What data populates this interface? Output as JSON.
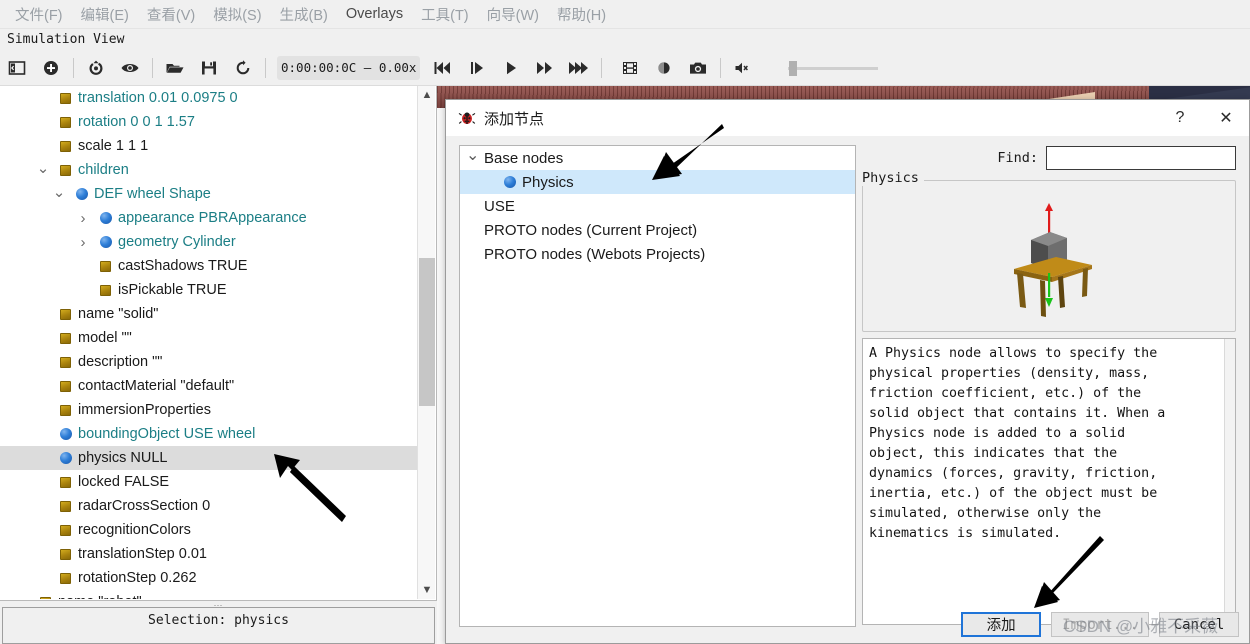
{
  "menubar": {
    "items": [
      {
        "label": "文件(F)",
        "muted": true
      },
      {
        "label": "编辑(E)",
        "muted": true
      },
      {
        "label": "查看(V)",
        "muted": true
      },
      {
        "label": "模拟(S)",
        "muted": true
      },
      {
        "label": "生成(B)",
        "muted": true
      },
      {
        "label": "Overlays",
        "muted": false
      },
      {
        "label": "工具(T)",
        "muted": true
      },
      {
        "label": "向导(W)",
        "muted": true
      },
      {
        "label": "帮助(H)",
        "muted": true
      }
    ]
  },
  "dock": {
    "title": "Simulation View"
  },
  "toolbar": {
    "time": "0:00:00:0C —  0.00x",
    "icons": [
      "sidebar-toggle-icon",
      "add-node-icon",
      "restore-viewpoint-icon",
      "view-icon",
      "open-world-icon",
      "save-world-icon",
      "reload-world-icon"
    ],
    "transport": [
      "rewind-icon",
      "step-icon",
      "play-icon",
      "fast-forward-icon",
      "realtime-icon"
    ],
    "media": [
      "movie-icon",
      "record-icon",
      "screenshot-icon"
    ],
    "sound": "mute-icon"
  },
  "scene_tree": {
    "rows": [
      {
        "twisty": "",
        "icon": "sf-field-icon",
        "indent": 60,
        "text": "translation 0.01 0.0975 0",
        "color": "teal",
        "selected": false
      },
      {
        "twisty": "",
        "icon": "sf-field-icon",
        "indent": 60,
        "text": "rotation 0 0 1 1.57",
        "color": "teal",
        "selected": false
      },
      {
        "twisty": "",
        "icon": "sf-field-icon",
        "indent": 60,
        "text": "scale 1 1 1",
        "color": "black",
        "selected": false
      },
      {
        "twisty": "down",
        "icon": "sf-field-icon",
        "indent": 60,
        "text": "children",
        "color": "teal",
        "selected": false
      },
      {
        "twisty": "down",
        "icon": "node-icon",
        "indent": 76,
        "text": "DEF wheel Shape",
        "color": "teal",
        "selected": false
      },
      {
        "twisty": "right",
        "icon": "node-icon",
        "indent": 100,
        "text": "appearance PBRAppearance",
        "color": "teal",
        "selected": false
      },
      {
        "twisty": "right",
        "icon": "node-icon",
        "indent": 100,
        "text": "geometry Cylinder",
        "color": "teal",
        "selected": false
      },
      {
        "twisty": "",
        "icon": "sf-field-icon",
        "indent": 100,
        "text": "castShadows TRUE",
        "color": "black",
        "selected": false
      },
      {
        "twisty": "",
        "icon": "sf-field-icon",
        "indent": 100,
        "text": "isPickable TRUE",
        "color": "black",
        "selected": false
      },
      {
        "twisty": "",
        "icon": "sf-field-icon",
        "indent": 60,
        "text": "name \"solid\"",
        "color": "black",
        "selected": false
      },
      {
        "twisty": "",
        "icon": "sf-field-icon",
        "indent": 60,
        "text": "model \"\"",
        "color": "black",
        "selected": false
      },
      {
        "twisty": "",
        "icon": "sf-field-icon",
        "indent": 60,
        "text": "description \"\"",
        "color": "black",
        "selected": false
      },
      {
        "twisty": "",
        "icon": "sf-field-icon",
        "indent": 60,
        "text": "contactMaterial \"default\"",
        "color": "black",
        "selected": false
      },
      {
        "twisty": "",
        "icon": "sf-field-icon",
        "indent": 60,
        "text": "immersionProperties",
        "color": "black",
        "selected": false
      },
      {
        "twisty": "",
        "icon": "node-icon",
        "indent": 60,
        "text": "boundingObject USE wheel",
        "color": "teal",
        "selected": false
      },
      {
        "twisty": "",
        "icon": "node-icon",
        "indent": 60,
        "text": "physics NULL",
        "color": "black",
        "selected": true
      },
      {
        "twisty": "",
        "icon": "sf-field-icon",
        "indent": 60,
        "text": "locked FALSE",
        "color": "black",
        "selected": false
      },
      {
        "twisty": "",
        "icon": "sf-field-icon",
        "indent": 60,
        "text": "radarCrossSection 0",
        "color": "black",
        "selected": false
      },
      {
        "twisty": "",
        "icon": "sf-field-icon",
        "indent": 60,
        "text": "recognitionColors",
        "color": "black",
        "selected": false
      },
      {
        "twisty": "",
        "icon": "sf-field-icon",
        "indent": 60,
        "text": "translationStep 0.01",
        "color": "black",
        "selected": false
      },
      {
        "twisty": "",
        "icon": "sf-field-icon",
        "indent": 60,
        "text": "rotationStep 0.262",
        "color": "black",
        "selected": false
      },
      {
        "twisty": "",
        "icon": "sf-field-icon",
        "indent": 40,
        "text": "name \"robot\"",
        "color": "black",
        "selected": false
      }
    ]
  },
  "status": {
    "text": "Selection: physics"
  },
  "dialog": {
    "title": "添加节点",
    "icon": "webots-bug-icon",
    "help_label": "?",
    "close_label": "✕",
    "node_list": [
      {
        "label": "Base nodes",
        "twisty": "down",
        "icon": "",
        "indent": false,
        "selected": false
      },
      {
        "label": "Physics",
        "twisty": "",
        "icon": "node-icon",
        "indent": true,
        "selected": true
      },
      {
        "label": "USE",
        "twisty": "",
        "icon": "",
        "indent": false,
        "selected": false
      },
      {
        "label": "PROTO nodes (Current Project)",
        "twisty": "",
        "icon": "",
        "indent": false,
        "selected": false
      },
      {
        "label": "PROTO nodes (Webots Projects)",
        "twisty": "",
        "icon": "",
        "indent": false,
        "selected": false
      }
    ],
    "find": {
      "label": "Find:",
      "value": "",
      "placeholder": ""
    },
    "preview": {
      "group_title": "Physics",
      "image": "physics-table-box-illustration"
    },
    "description": "A Physics node allows to specify the\nphysical properties (density, mass,\nfriction coefficient, etc.) of the\nsolid object that contains it. When a\nPhysics node is added to a solid\nobject, this indicates that the\ndynamics (forces, gravity, friction,\ninertia, etc.) of the object must be\nsimulated, otherwise only the\nkinematics is simulated.",
    "buttons": {
      "add": "添加",
      "import": "Import...",
      "cancel": "Cancel"
    }
  },
  "watermark": {
    "text": "CSDN @小雅不采薇"
  },
  "colors": {
    "accent_blue": "#1f74d8",
    "selection_blue": "#cfe8fb",
    "selection_grey": "#dcdcdc",
    "field_teal": "#1b7e85",
    "sf_icon_gold": "#a9820d",
    "node_icon_blue": "#2f7fd8"
  }
}
